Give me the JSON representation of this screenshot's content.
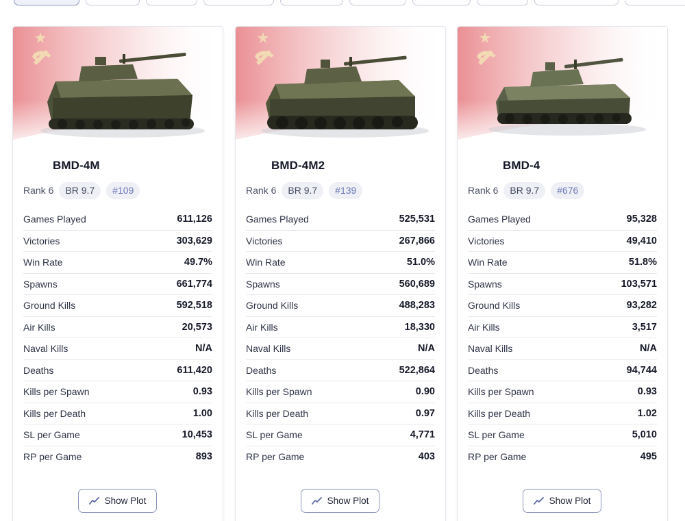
{
  "tabs": [
    {
      "id": "tab-1",
      "active": true
    },
    {
      "id": "tab-2",
      "active": false
    },
    {
      "id": "tab-3",
      "active": false
    },
    {
      "id": "tab-4",
      "active": false
    },
    {
      "id": "tab-5",
      "active": false
    },
    {
      "id": "tab-6",
      "active": false
    },
    {
      "id": "tab-7",
      "active": false
    },
    {
      "id": "tab-8",
      "active": false
    },
    {
      "id": "tab-9",
      "active": false
    },
    {
      "id": "tab-10",
      "active": false
    }
  ],
  "stat_labels": {
    "games_played": "Games Played",
    "victories": "Victories",
    "win_rate": "Win Rate",
    "spawns": "Spawns",
    "ground_kills": "Ground Kills",
    "air_kills": "Air Kills",
    "naval_kills": "Naval Kills",
    "deaths": "Deaths",
    "kills_per_spawn": "Kills per Spawn",
    "kills_per_death": "Kills per Death",
    "sl_per_game": "SL per Game",
    "rp_per_game": "RP per Game"
  },
  "show_plot_label": "Show Plot",
  "colors": {
    "accent": "#6b77b5",
    "button_border": "#8b93bd",
    "flag_red": "#d9343b",
    "pill_bg": "#eef0f6"
  },
  "vehicles": [
    {
      "name": "BMD-4M",
      "rank": "Rank 6",
      "br": "BR 9.7",
      "position": "#109",
      "stats": {
        "games_played": "611,126",
        "victories": "303,629",
        "win_rate": "49.7%",
        "spawns": "661,774",
        "ground_kills": "592,518",
        "air_kills": "20,573",
        "naval_kills": "N/A",
        "deaths": "611,420",
        "kills_per_spawn": "0.93",
        "kills_per_death": "1.00",
        "sl_per_game": "10,453",
        "rp_per_game": "893"
      }
    },
    {
      "name": "BMD-4M2",
      "rank": "Rank 6",
      "br": "BR 9.7",
      "position": "#139",
      "stats": {
        "games_played": "525,531",
        "victories": "267,866",
        "win_rate": "51.0%",
        "spawns": "560,689",
        "ground_kills": "488,283",
        "air_kills": "18,330",
        "naval_kills": "N/A",
        "deaths": "522,864",
        "kills_per_spawn": "0.90",
        "kills_per_death": "0.97",
        "sl_per_game": "4,771",
        "rp_per_game": "403"
      }
    },
    {
      "name": "BMD-4",
      "rank": "Rank 6",
      "br": "BR 9.7",
      "position": "#676",
      "stats": {
        "games_played": "95,328",
        "victories": "49,410",
        "win_rate": "51.8%",
        "spawns": "103,571",
        "ground_kills": "93,282",
        "air_kills": "3,517",
        "naval_kills": "N/A",
        "deaths": "94,744",
        "kills_per_spawn": "0.93",
        "kills_per_death": "1.02",
        "sl_per_game": "5,010",
        "rp_per_game": "495"
      }
    }
  ]
}
